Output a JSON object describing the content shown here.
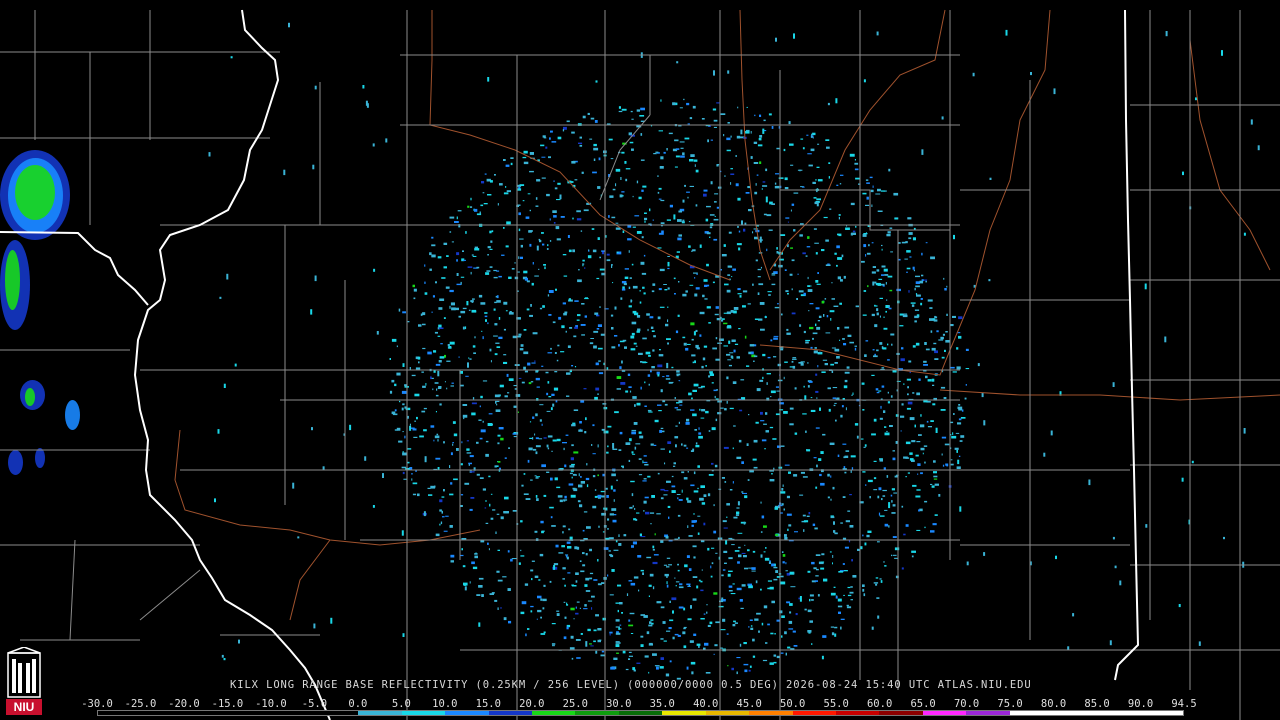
{
  "product": {
    "title_text": "KILX LONG RANGE BASE REFLECTIVITY (0.25KM / 256 LEVEL) (000000/0000 0.5 DEG) 2026-08-24 15:40 UTC  ATLAS.NIU.EDU"
  },
  "legend": {
    "labels": [
      "-30.0",
      "-25.0",
      "-20.0",
      "-15.0",
      "-10.0",
      "-5.0",
      "0.0",
      "5.0",
      "10.0",
      "15.0",
      "20.0",
      "25.0",
      "30.0",
      "35.0",
      "40.0",
      "45.0",
      "50.0",
      "55.0",
      "60.0",
      "65.0",
      "70.0",
      "75.0",
      "80.0",
      "85.0",
      "90.0",
      "94.5"
    ],
    "colors": [
      "#000000",
      "#000000",
      "#000000",
      "#000000",
      "#000000",
      "#000000",
      "#3ab4d6",
      "#19d8e8",
      "#1a88ff",
      "#1437c8",
      "#18d818",
      "#0e9c0e",
      "#086e08",
      "#e8e800",
      "#e8b800",
      "#ff8000",
      "#ff1800",
      "#c80000",
      "#8c0000",
      "#ff28ff",
      "#9c28d8",
      "#ffffff",
      "#ffffff",
      "#ffffff",
      "#ffffff"
    ]
  },
  "map": {
    "state_border_color": "#ffffff",
    "county_border_color": "#8c8c8c",
    "highway_color": "#a0522d",
    "echo_colors": [
      "#3ab4d6",
      "#19d8e8",
      "#1a88ff",
      "#1437c8",
      "#18d818"
    ]
  },
  "logo": {
    "text": "NIU",
    "color": "#c8102e"
  }
}
